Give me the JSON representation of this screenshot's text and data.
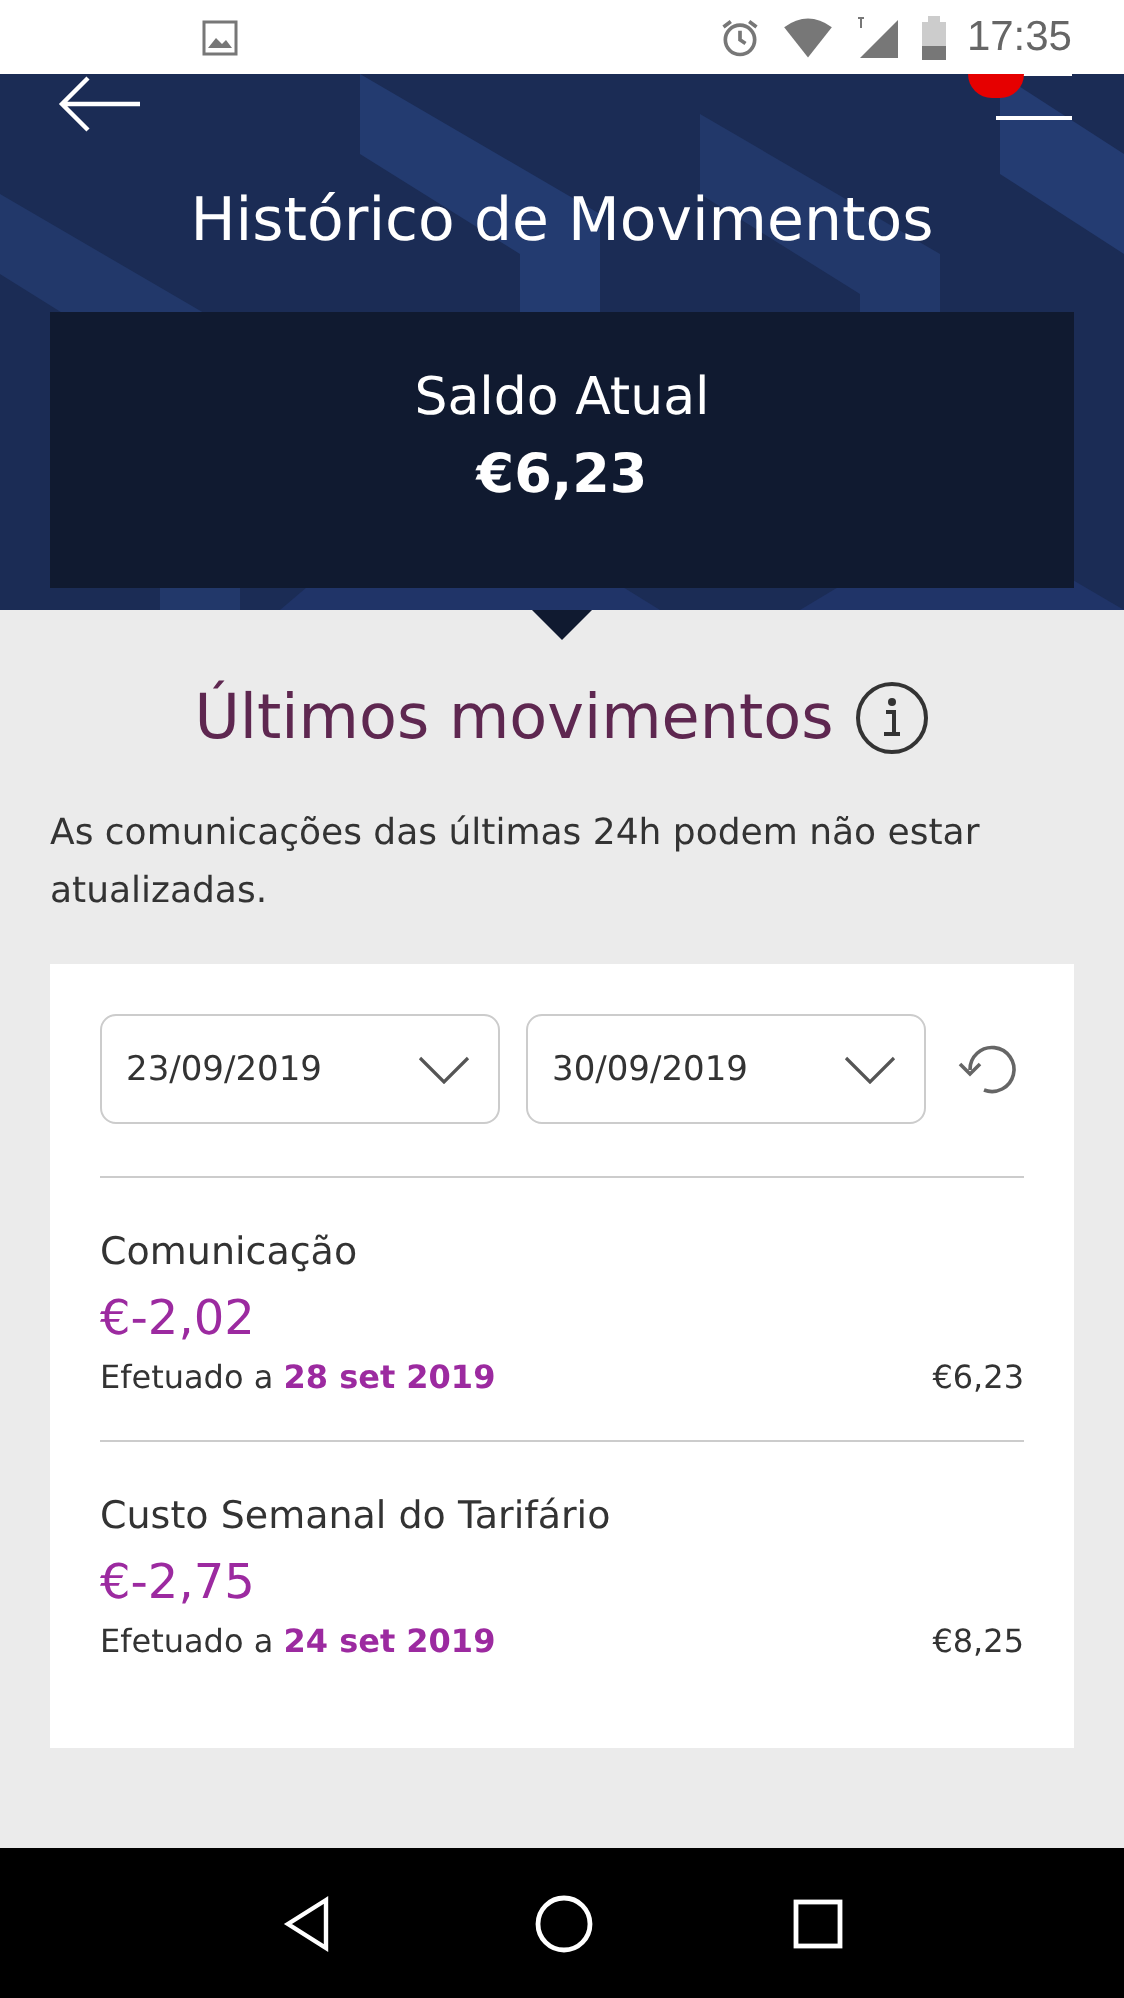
{
  "status_bar": {
    "time": "17:35"
  },
  "header": {
    "title": "Histórico de Movimentos"
  },
  "balance": {
    "label": "Saldo Atual",
    "amount": "€6,23"
  },
  "section": {
    "title": "Últimos movimentos",
    "note": "As comunicações das últimas 24h podem não estar atualizadas."
  },
  "date_filters": [
    {
      "value": "23/09/2019"
    },
    {
      "value": "30/09/2019"
    }
  ],
  "movements": [
    {
      "title": "Comunicação",
      "amount": "€-2,02",
      "date": "Efetuado a **28 set 2019**",
      "balance": "€6,23"
    },
    {
      "title": "Custo Semanal do Tarifário",
      "amount": "€-2,75",
      "date": "Efetuado a **24 set 2019**",
      "balance": "€8,25"
    }
  ]
}
